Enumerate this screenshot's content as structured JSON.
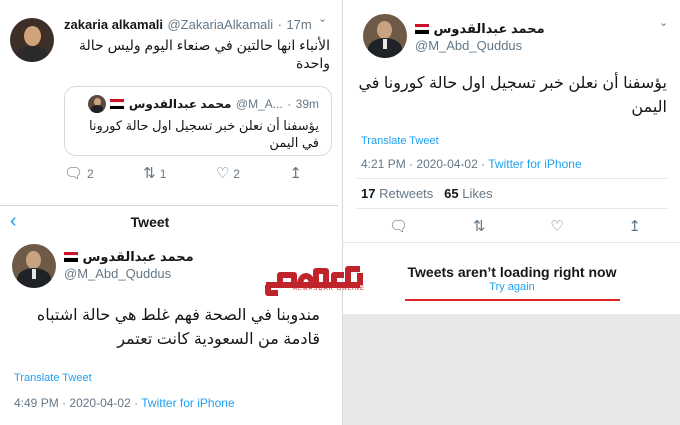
{
  "quoter": {
    "name": "zakaria alkamali",
    "handle": "@ZakariaAlkamali",
    "sep": "·",
    "time": "17m",
    "text": "الأنباء انها حالتين في صنعاء اليوم وليس حالة واحدة"
  },
  "quoted": {
    "name": "محمد عبدالقدوس",
    "handle": "@M_A...",
    "sep": "·",
    "time": "39m",
    "text": "يؤسفنا أن نعلن خبر تسجيل اول حالة كورونا في اليمن"
  },
  "quoter_actions": {
    "reply_count": "2",
    "retweet_count": "1",
    "like_count": "2"
  },
  "detail_header": {
    "back_icon": "chevron-left-icon",
    "title": "Tweet"
  },
  "tweet2": {
    "name": "محمد عبدالقدوس",
    "handle": "@M_Abd_Quddus",
    "text": "مندوبنا في الصحة فهم غلط هي حالة اشتباه قادمة من السعودية كانت تعتمر",
    "translate": "Translate Tweet",
    "time": "4:49 PM",
    "date": "2020-04-02",
    "source": "Twitter for iPhone",
    "sep": "·"
  },
  "tweet1": {
    "name": "محمد عبدالقدوس",
    "handle": "@M_Abd_Quddus",
    "text": "يؤسفنا أن نعلن خبر تسجيل اول حالة كورونا في اليمن",
    "translate": "Translate Tweet",
    "time": "4:21 PM",
    "date": "2020-04-02",
    "source": "Twitter for iPhone",
    "sep": "·",
    "retweets": "17",
    "retweets_label": "Retweets",
    "likes": "65",
    "likes_label": "Likes"
  },
  "error": {
    "title": "Tweets aren’t loading right now",
    "retry": "Try again"
  },
  "watermark": {
    "logo": "مصدر",
    "sub": "ALMASDAR ONLINE"
  },
  "colors": {
    "accent": "#1da1f2",
    "muted": "#657786",
    "watermark": "#c0242b",
    "error_line": "#e02424"
  }
}
